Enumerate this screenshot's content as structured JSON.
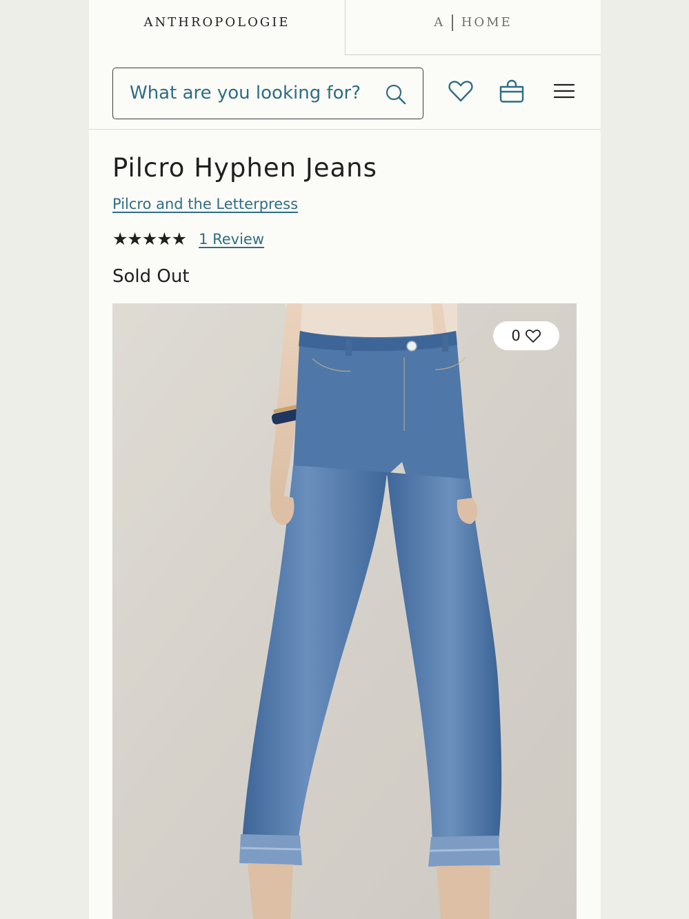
{
  "brand_tabs": {
    "primary": "ANTHROPOLOGIE",
    "secondary_prefix": "A",
    "secondary_label": "HOME"
  },
  "header": {
    "search_placeholder": "What are you looking for?",
    "icons": [
      "search-icon",
      "heart-icon",
      "shopping-bag-icon",
      "hamburger-menu-icon"
    ]
  },
  "product": {
    "title": "Pilcro Hyphen Jeans",
    "brand": "Pilcro and the Letterpress",
    "rating": 5,
    "stars_display": "★★★★★",
    "reviews_label": "1 Review",
    "status": "Sold Out",
    "favorites_count": "0"
  },
  "colors": {
    "accent": "#2e6d82",
    "text": "#1f1f1f",
    "page_bg": "#fbfbf8",
    "denim": "#4a72a6"
  }
}
